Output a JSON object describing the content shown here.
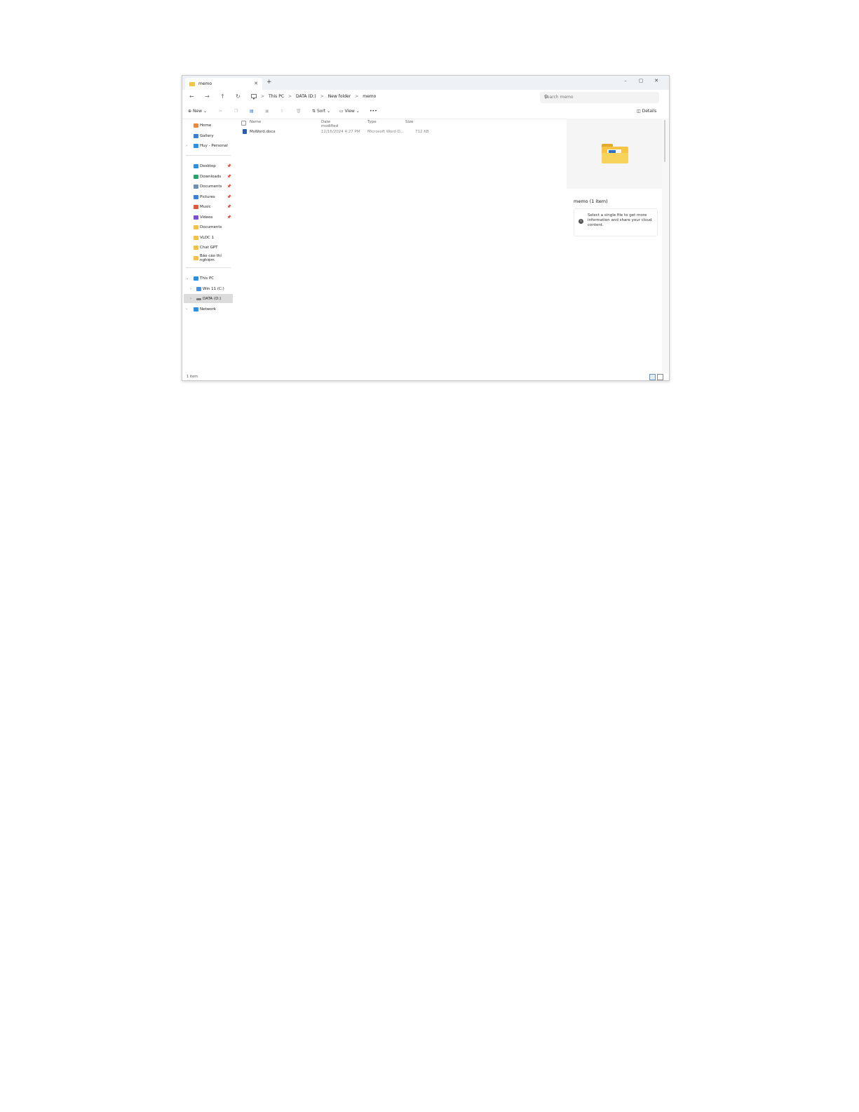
{
  "tab": {
    "title": "memo",
    "close": "✕",
    "new": "+"
  },
  "window_controls": {
    "minimize": "–",
    "maximize": "▢",
    "close": "✕"
  },
  "nav_buttons": {
    "back": "←",
    "forward": "→",
    "up": "↑",
    "refresh": "↻"
  },
  "address": {
    "pc_icon": "monitor-icon",
    "crumbs": [
      "This PC",
      "DATA (D:)",
      "New folder",
      "memo"
    ],
    "separator": ">"
  },
  "search": {
    "placeholder": "Search memo",
    "icon": "search-icon"
  },
  "commands": {
    "new": "New",
    "sort": "Sort",
    "view": "View",
    "more": "•••",
    "details": "Details"
  },
  "sidebar": {
    "quick": [
      {
        "label": "Home",
        "color": "#e8883a"
      },
      {
        "label": "Gallery",
        "color": "#3b7fd4"
      },
      {
        "label": "Huy - Personal",
        "color": "#2b8fe6"
      }
    ],
    "pinned": [
      {
        "label": "Desktop",
        "color": "#2d8fe0",
        "pin": "📌"
      },
      {
        "label": "Downloads",
        "color": "#2aa36b",
        "pin": "📌"
      },
      {
        "label": "Documents",
        "color": "#6e8fb0",
        "pin": "📌"
      },
      {
        "label": "Pictures",
        "color": "#3a7fd8",
        "pin": "📌"
      },
      {
        "label": "Music",
        "color": "#e05a3a",
        "pin": "📌"
      },
      {
        "label": "Videos",
        "color": "#7a4fd0",
        "pin": "📌"
      },
      {
        "label": "Documents",
        "color": "#f3c242"
      },
      {
        "label": "VLDC 1",
        "color": "#f3c242"
      },
      {
        "label": "Chat GPT",
        "color": "#f3c242"
      },
      {
        "label": "Báo cáo thí nghiệm",
        "color": "#f3c242"
      }
    ],
    "drives": [
      {
        "label": "This PC",
        "color": "#2b8fe6",
        "chev": "⌄"
      },
      {
        "label": "Win 11 (C:)",
        "color": "#4a90d9",
        "chev": "›"
      },
      {
        "label": "DATA (D:)",
        "color": "#7a7a7a",
        "chev": "›"
      },
      {
        "label": "Network",
        "color": "#2b8fe6",
        "chev": "›"
      }
    ]
  },
  "columns": {
    "name": "Name",
    "date": "Date modified",
    "type": "Type",
    "size": "Size"
  },
  "files": [
    {
      "name": "MsWord.docx",
      "date": "12/16/2024 4:27 PM",
      "type": "Microsoft Word D...",
      "size": "712 KB"
    }
  ],
  "details_pane": {
    "title": "memo (1 item)",
    "info": "Select a single file to get more information and share your cloud content.",
    "info_icon": "info-icon"
  },
  "status": {
    "count": "1 item"
  }
}
